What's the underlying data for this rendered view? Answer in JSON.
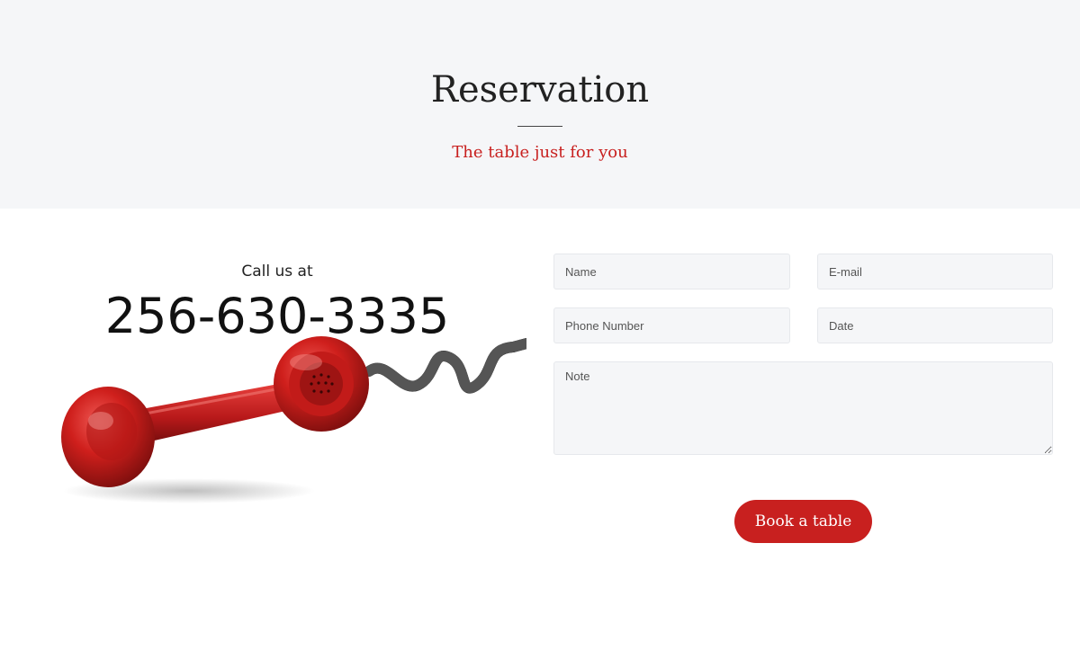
{
  "hero": {
    "title": "Reservation",
    "subtitle": "The table just for you"
  },
  "contact": {
    "call_label": "Call us at",
    "phone_number": "256-630-3335"
  },
  "form": {
    "name_placeholder": "Name",
    "email_placeholder": "E-mail",
    "phone_placeholder": "Phone Number",
    "date_placeholder": "Date",
    "note_placeholder": "Note",
    "submit_label": "Book a table"
  },
  "colors": {
    "accent": "#c8201f",
    "hero_background": "#f5f6f8",
    "field_background": "#f5f6f8"
  },
  "icons": {
    "illustration": "red-telephone-handset"
  }
}
